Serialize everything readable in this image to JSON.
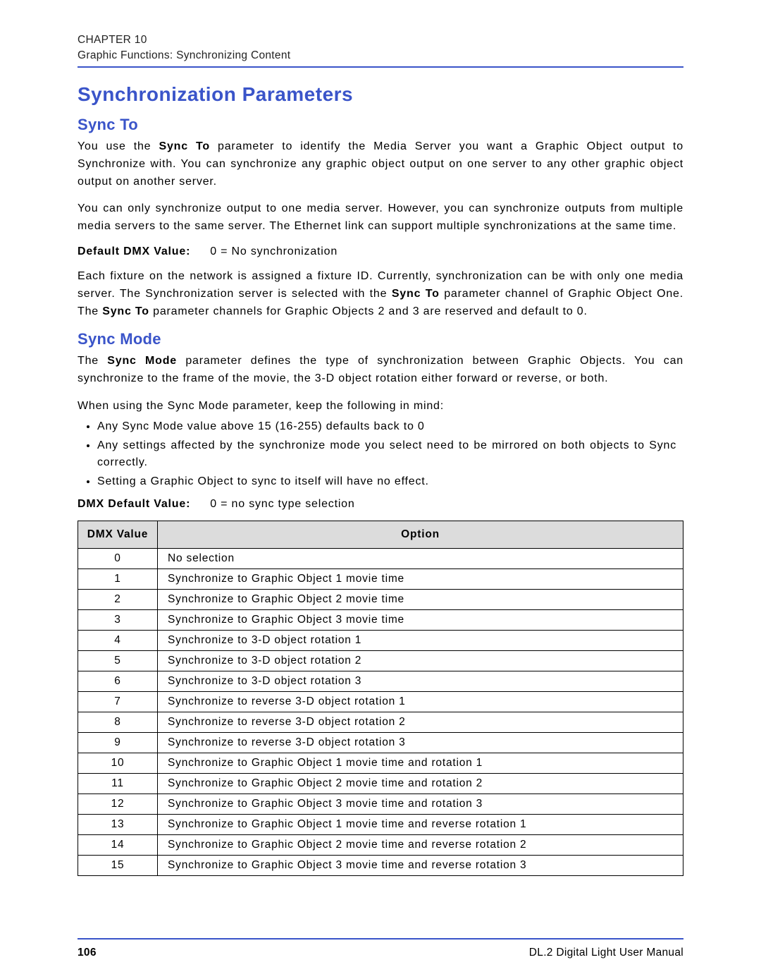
{
  "header": {
    "chapter": "CHAPTER 10",
    "section": "Graphic Functions: Synchronizing Content"
  },
  "h1": "Synchronization Parameters",
  "sync_to": {
    "heading": "Sync To",
    "p1_a": "You use the ",
    "p1_b": "Sync To",
    "p1_c": " parameter to identify the Media Server you want a Graphic Object output to Synchronize with. You can synchronize any graphic object output on one server to any other graphic object output on another server.",
    "p2": "You can only synchronize output to one media server. However, you can synchronize outputs from multiple media servers to the same server. The Ethernet link can support multiple synchronizations at the same time.",
    "default_label": "Default DMX Value:",
    "default_value": "0 = No synchronization",
    "p3_a": "Each fixture on the network is assigned a fixture ID. Currently, synchronization can be with only one media server. The Synchronization server is selected with the ",
    "p3_b": "Sync To",
    "p3_c": " parameter channel of Graphic Object One. The ",
    "p3_d": "Sync To",
    "p3_e": " parameter channels for Graphic Objects 2 and 3 are reserved and default to 0."
  },
  "sync_mode": {
    "heading": "Sync Mode",
    "p1_a": "The ",
    "p1_b": "Sync Mode",
    "p1_c": " parameter defines the type of synchronization between Graphic Objects. You can synchronize to the frame of the movie, the 3-D object rotation either forward or reverse, or both.",
    "p2": "When using the Sync Mode parameter, keep the following in mind:",
    "bullets": [
      "Any Sync Mode value above 15 (16-255) defaults back to 0",
      "Any settings affected by the synchronize mode you select need to be mirrored on both objects to Sync correctly.",
      "Setting a Graphic Object to sync to itself will have no effect."
    ],
    "default_label": "DMX Default Value:",
    "default_value": "0 = no sync type selection",
    "table": {
      "headers": [
        "DMX Value",
        "Option"
      ],
      "rows": [
        {
          "v": "0",
          "o": "No selection"
        },
        {
          "v": "1",
          "o": "Synchronize to Graphic Object 1 movie time"
        },
        {
          "v": "2",
          "o": "Synchronize to Graphic Object 2 movie time"
        },
        {
          "v": "3",
          "o": "Synchronize to Graphic Object 3 movie time"
        },
        {
          "v": "4",
          "o": "Synchronize to 3-D object rotation 1"
        },
        {
          "v": "5",
          "o": "Synchronize to 3-D object rotation 2"
        },
        {
          "v": "6",
          "o": "Synchronize to 3-D object rotation 3"
        },
        {
          "v": "7",
          "o": "Synchronize to reverse 3-D object rotation 1"
        },
        {
          "v": "8",
          "o": "Synchronize to reverse 3-D object rotation 2"
        },
        {
          "v": "9",
          "o": "Synchronize to reverse 3-D object rotation 3"
        },
        {
          "v": "10",
          "o": "Synchronize to Graphic Object 1 movie time and rotation 1"
        },
        {
          "v": "11",
          "o": "Synchronize to Graphic Object 2 movie time and rotation 2"
        },
        {
          "v": "12",
          "o": "Synchronize to Graphic Object 3 movie time and rotation 3"
        },
        {
          "v": "13",
          "o": "Synchronize to Graphic Object 1 movie time and reverse rotation 1"
        },
        {
          "v": "14",
          "o": "Synchronize to Graphic Object 2 movie time and reverse rotation 2"
        },
        {
          "v": "15",
          "o": "Synchronize to Graphic Object 3 movie time and reverse rotation 3"
        }
      ]
    }
  },
  "footer": {
    "page": "106",
    "manual": "DL.2 Digital Light User Manual"
  }
}
